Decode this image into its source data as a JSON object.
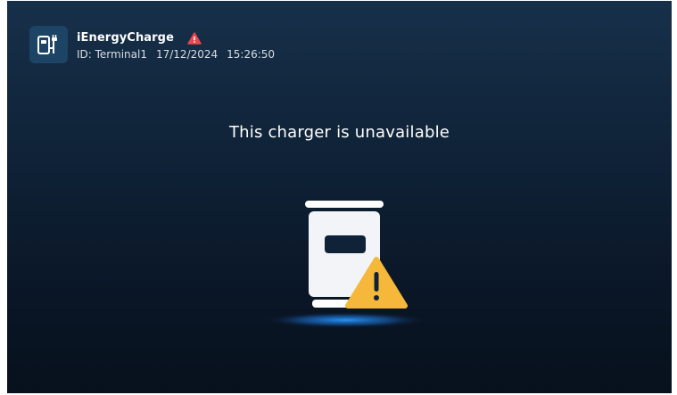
{
  "app": {
    "name": "iEnergyCharge",
    "id_label": "ID: Terminal1",
    "date": "17/12/2024",
    "time": "15:26:50"
  },
  "icons": {
    "logo": "ev-charger-plug-icon",
    "header_alert": "warning-triangle-icon",
    "illustration": "charger-unavailable-illustration"
  },
  "status": {
    "message": "This charger is unavailable"
  },
  "colors": {
    "background_top": "#17304a",
    "background_bottom": "#07111d",
    "alert_red": "#e5484d",
    "warning_yellow": "#f5b83a",
    "glow_blue": "#1a8cff"
  }
}
